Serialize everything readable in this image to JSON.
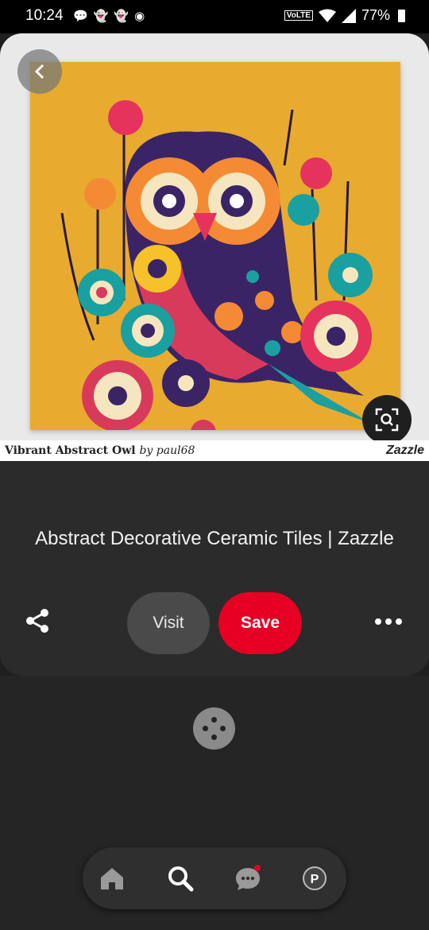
{
  "status_bar": {
    "time": "10:24",
    "volte": "VoLTE",
    "battery": "77%"
  },
  "pin": {
    "product_name": "Vibrant Abstract Owl",
    "by_author": "by paul68",
    "brand": "Zazzle",
    "title": "Abstract Decorative Ceramic Tiles | Zazzle"
  },
  "actions": {
    "visit_label": "Visit",
    "save_label": "Save"
  },
  "colors": {
    "save": "#e60023",
    "tile_background": "#e8ab2f"
  },
  "nav": {
    "items": [
      "home-icon",
      "search-icon",
      "messages-icon",
      "profile-icon"
    ],
    "profile_initial": "P"
  }
}
